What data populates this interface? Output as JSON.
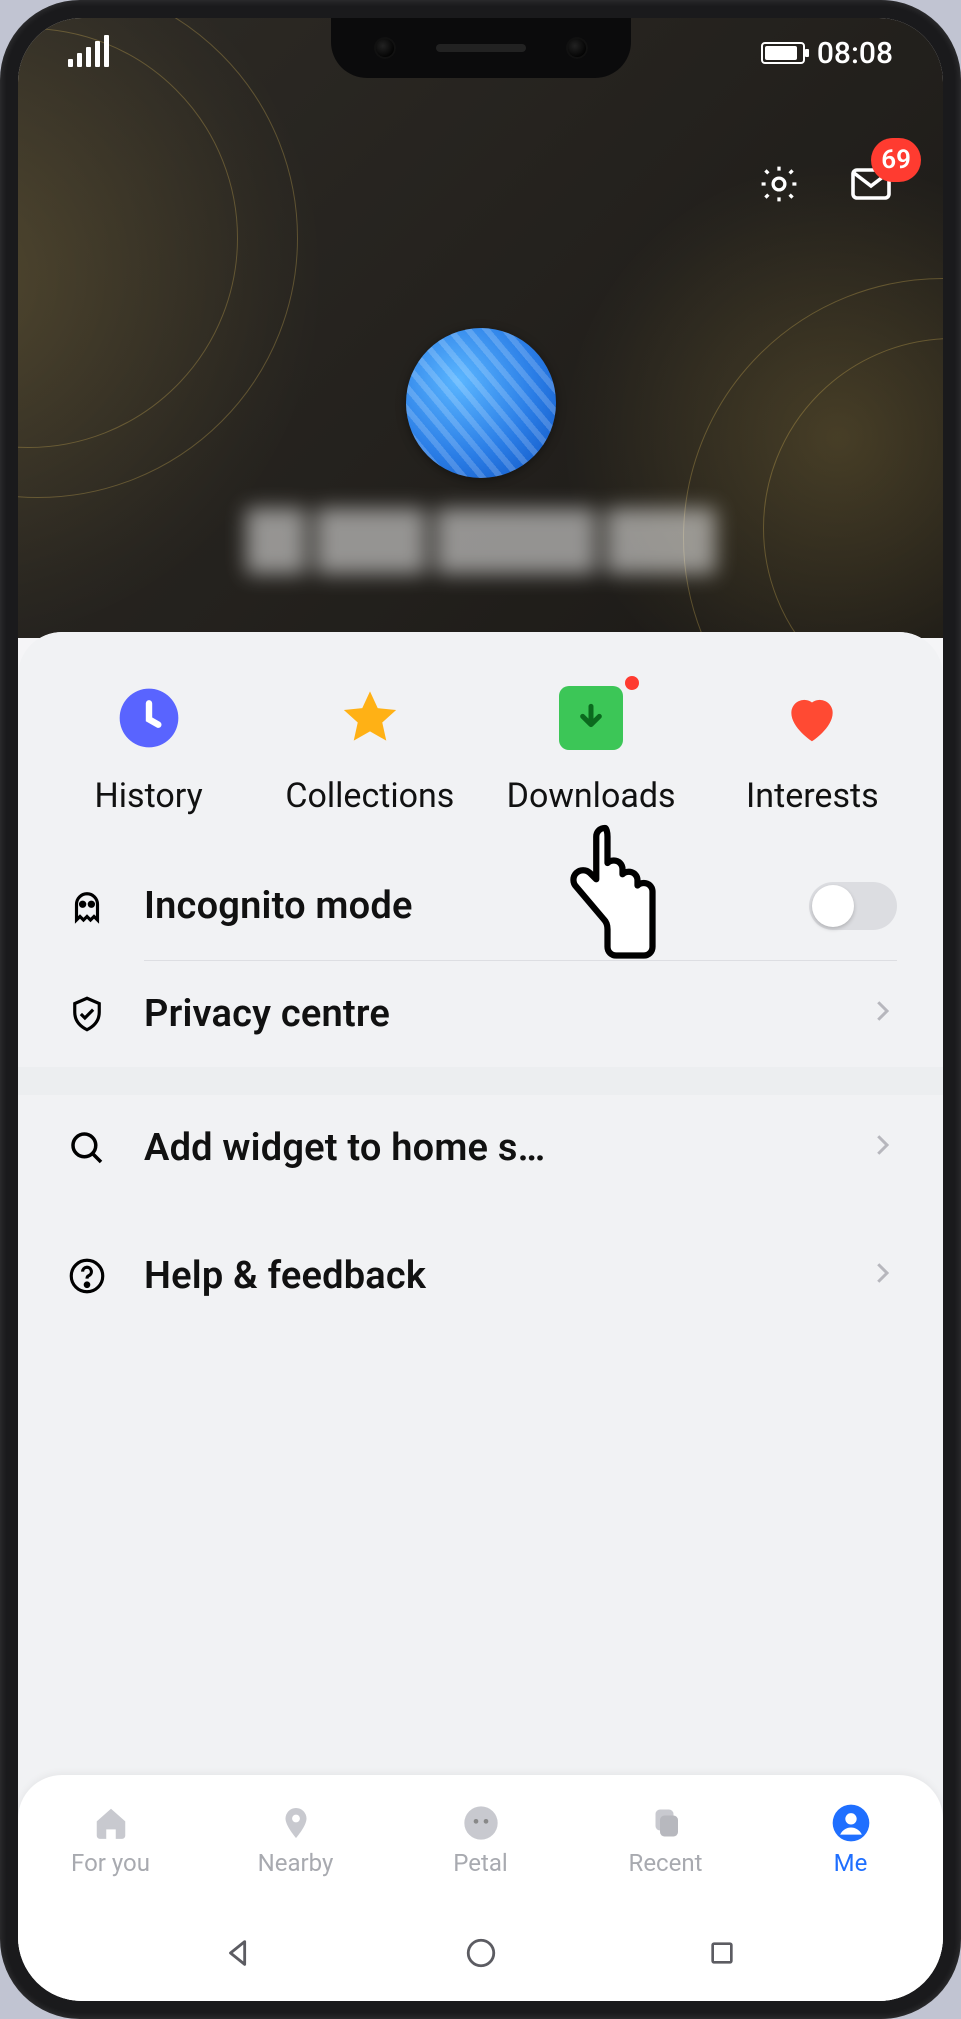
{
  "status": {
    "time": "08:08"
  },
  "header": {
    "settings_icon": "gear",
    "messages_icon": "envelope",
    "messages_badge": "69"
  },
  "quick": [
    {
      "id": "history",
      "label": "History",
      "icon": "clock",
      "color": "#5964ff",
      "dot": false
    },
    {
      "id": "collections",
      "label": "Collections",
      "icon": "star",
      "color": "#ffb115",
      "dot": false
    },
    {
      "id": "downloads",
      "label": "Downloads",
      "icon": "download",
      "color": "#3cc657",
      "dot": true
    },
    {
      "id": "interests",
      "label": "Interests",
      "icon": "heart",
      "color": "#ff4a33",
      "dot": false
    }
  ],
  "settings": {
    "incognito": {
      "label": "Incognito mode",
      "icon": "ghost",
      "toggle": false
    },
    "privacy": {
      "label": "Privacy centre",
      "icon": "shield"
    },
    "widget": {
      "label": "Add widget to home s…",
      "icon": "search"
    },
    "help": {
      "label": "Help & feedback",
      "icon": "help"
    }
  },
  "bottomnav": [
    {
      "id": "foryou",
      "label": "For you",
      "icon": "home",
      "active": false
    },
    {
      "id": "nearby",
      "label": "Nearby",
      "icon": "pin",
      "active": false
    },
    {
      "id": "petal",
      "label": "Petal",
      "icon": "face",
      "active": false
    },
    {
      "id": "recent",
      "label": "Recent",
      "icon": "stack",
      "active": false
    },
    {
      "id": "me",
      "label": "Me",
      "icon": "person",
      "active": true
    }
  ]
}
